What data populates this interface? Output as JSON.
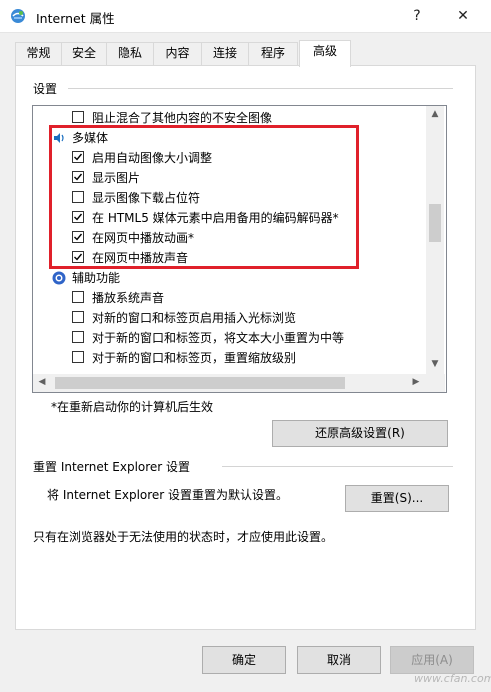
{
  "window": {
    "title": "Internet 属性",
    "help_btn": "?",
    "close_btn": "✕"
  },
  "tabs": [
    {
      "label": "常规"
    },
    {
      "label": "安全"
    },
    {
      "label": "隐私"
    },
    {
      "label": "内容"
    },
    {
      "label": "连接"
    },
    {
      "label": "程序"
    },
    {
      "label": "高级",
      "active": true
    }
  ],
  "settings": {
    "label": "设置",
    "items": [
      {
        "type": "checkbox",
        "label": "阻止混合了其他内容的不安全图像",
        "checked": false
      },
      {
        "type": "category",
        "label": "多媒体",
        "icon": "multimedia-icon"
      },
      {
        "type": "checkbox",
        "label": "启用自动图像大小调整",
        "checked": true
      },
      {
        "type": "checkbox",
        "label": "显示图片",
        "checked": true
      },
      {
        "type": "checkbox",
        "label": "显示图像下载占位符",
        "checked": false
      },
      {
        "type": "checkbox",
        "label": "在 HTML5 媒体元素中启用备用的编码解码器*",
        "checked": true
      },
      {
        "type": "checkbox",
        "label": "在网页中播放动画*",
        "checked": true
      },
      {
        "type": "checkbox",
        "label": "在网页中播放声音",
        "checked": true
      },
      {
        "type": "category",
        "label": "辅助功能",
        "icon": "accessibility-icon"
      },
      {
        "type": "checkbox",
        "label": "播放系统声音",
        "checked": false
      },
      {
        "type": "checkbox",
        "label": "对新的窗口和标签页启用插入光标浏览",
        "checked": false
      },
      {
        "type": "checkbox",
        "label": "对于新的窗口和标签页，将文本大小重置为中等",
        "checked": false
      },
      {
        "type": "checkbox",
        "label": "对于新的窗口和标签页，重置缩放级别",
        "checked": false
      }
    ],
    "note": "*在重新启动你的计算机后生效",
    "restore_btn": "还原高级设置(R)"
  },
  "reset": {
    "heading": "重置 Internet Explorer 设置",
    "desc": "将 Internet Explorer 设置重置为默认设置。",
    "reset_btn": "重置(S)...",
    "hint": "只有在浏览器处于无法使用的状态时，才应使用此设置。"
  },
  "footer": {
    "ok": "确定",
    "cancel": "取消",
    "apply": "应用(A)"
  },
  "watermark": "www.cfan.com.cn"
}
